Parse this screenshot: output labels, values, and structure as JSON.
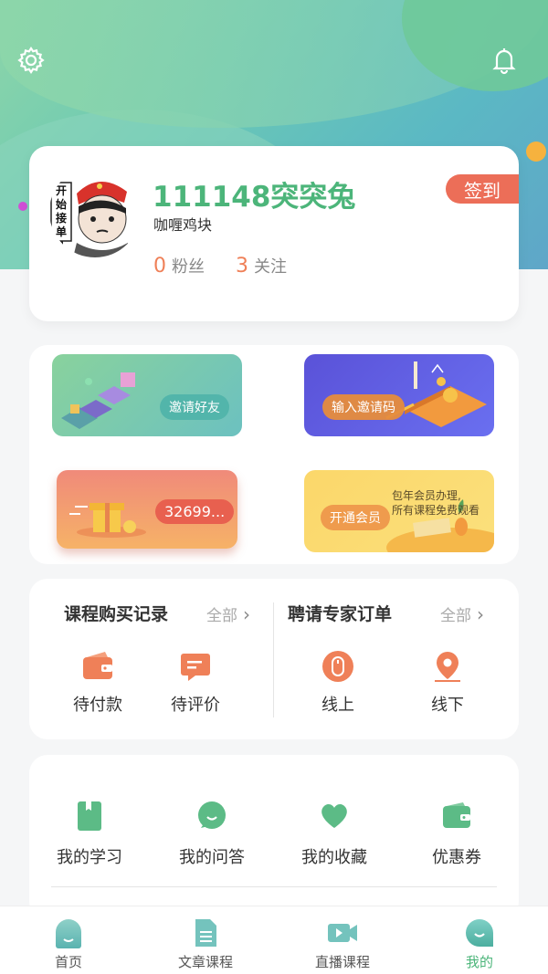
{
  "colors": {
    "accent": "#4cb57a",
    "orange": "#ef8058",
    "signin": "#ec6e58"
  },
  "header": {
    "settings_icon": "gear-icon",
    "notify_icon": "bell-icon"
  },
  "profile": {
    "username": "111148突突兔",
    "nickname": "咖喱鸡块",
    "fans_count": "0",
    "fans_label": "粉丝",
    "follow_count": "3",
    "follow_label": "关注",
    "signin_label": "签到",
    "avatar_sign_text": "开始接单"
  },
  "promos": {
    "invite_friends": "邀请好友",
    "enter_code": "输入邀请码",
    "balance": "32699...",
    "membership_button": "开通会员",
    "membership_line1": "包年会员办理,",
    "membership_line2": "所有课程免费观看"
  },
  "orders": {
    "left": {
      "title": "课程购买记录",
      "all": "全部",
      "items": [
        {
          "label": "待付款",
          "icon": "wallet-icon"
        },
        {
          "label": "待评价",
          "icon": "comment-icon"
        }
      ]
    },
    "right": {
      "title": "聘请专家订单",
      "all": "全部",
      "items": [
        {
          "label": "线上",
          "icon": "mouse-icon"
        },
        {
          "label": "线下",
          "icon": "location-icon"
        }
      ]
    }
  },
  "tools": [
    {
      "label": "我的学习",
      "icon": "book-icon"
    },
    {
      "label": "我的问答",
      "icon": "chat-bubble-icon"
    },
    {
      "label": "我的收藏",
      "icon": "heart-icon"
    },
    {
      "label": "优惠券",
      "icon": "coupon-wallet-icon"
    }
  ],
  "tabbar": [
    {
      "label": "首页",
      "icon": "home-icon"
    },
    {
      "label": "文章课程",
      "icon": "document-icon"
    },
    {
      "label": "直播课程",
      "icon": "video-icon"
    },
    {
      "label": "我的",
      "icon": "profile-icon",
      "active": true
    }
  ]
}
